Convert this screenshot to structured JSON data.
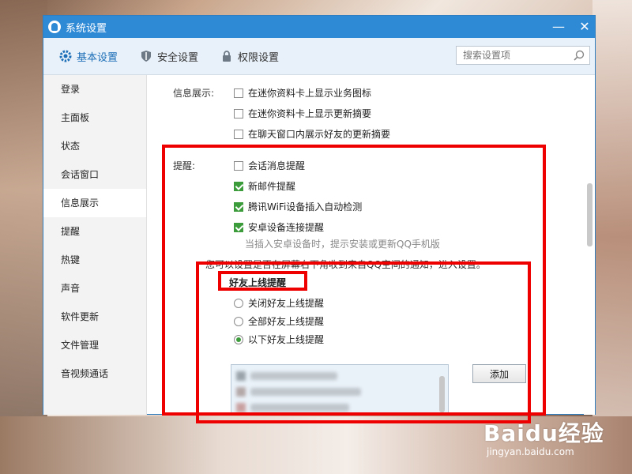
{
  "window": {
    "title": "系统设置",
    "minimize": "—",
    "close": "✕"
  },
  "toolbar": {
    "tabs": [
      {
        "label": "基本设置",
        "icon": "gear-icon",
        "active": true
      },
      {
        "label": "安全设置",
        "icon": "shield-icon",
        "active": false
      },
      {
        "label": "权限设置",
        "icon": "lock-icon",
        "active": false
      }
    ],
    "search_placeholder": "搜索设置项"
  },
  "sidebar": {
    "items": [
      {
        "label": "登录"
      },
      {
        "label": "主面板"
      },
      {
        "label": "状态"
      },
      {
        "label": "会话窗口"
      },
      {
        "label": "信息展示",
        "active": true
      },
      {
        "label": "提醒"
      },
      {
        "label": "热键"
      },
      {
        "label": "声音"
      },
      {
        "label": "软件更新"
      },
      {
        "label": "文件管理"
      },
      {
        "label": "音视频通话"
      }
    ]
  },
  "info_display": {
    "label": "信息展示:",
    "options": [
      {
        "label": "在迷你资料卡上显示业务图标",
        "checked": false
      },
      {
        "label": "在迷你资料卡上显示更新摘要",
        "checked": false
      },
      {
        "label": "在聊天窗口内展示好友的更新摘要",
        "checked": false
      }
    ]
  },
  "reminders": {
    "label": "提醒:",
    "options": [
      {
        "label": "会话消息提醒",
        "checked": false
      },
      {
        "label": "新邮件提醒",
        "checked": true
      },
      {
        "label": "腾讯WiFi设备插入自动检测",
        "checked": true
      },
      {
        "label": "安卓设备连接提醒",
        "checked": true
      }
    ],
    "android_hint": "当插入安卓设备时，提示安装或更新QQ手机版",
    "partial_text": "您可以设置是否在屏幕右下角收到来自QQ空间的通知，进入设置。"
  },
  "friend_online": {
    "title": "好友上线提醒",
    "radios": [
      {
        "label": "关闭好友上线提醒",
        "checked": false
      },
      {
        "label": "全部好友上线提醒",
        "checked": false
      },
      {
        "label": "以下好友上线提醒",
        "checked": true
      }
    ],
    "add_button": "添加"
  },
  "watermark": {
    "logo": "Baidu经验",
    "url": "jingyan.baidu.com"
  },
  "colors": {
    "titlebar": "#2f8ad6",
    "highlight": "#ee0000",
    "check": "#3c9c3c"
  }
}
